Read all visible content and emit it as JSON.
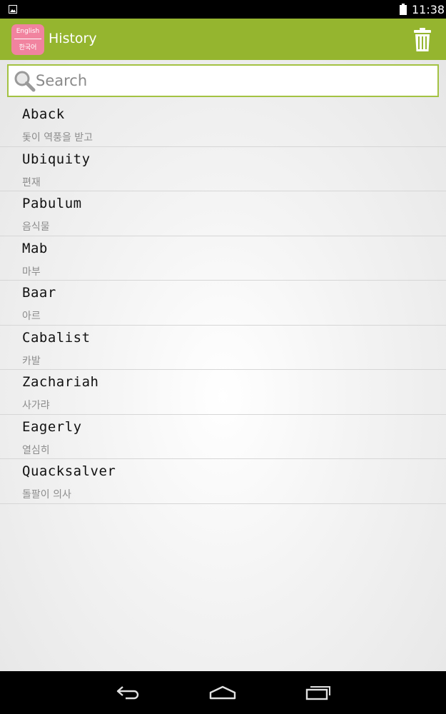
{
  "status_bar": {
    "time": "11:38",
    "icons": [
      "notification-image-icon",
      "battery-icon"
    ]
  },
  "app_bar": {
    "logo_top": "English",
    "logo_bottom": "한국어",
    "title": "History",
    "action_icon": "trash-icon",
    "accent_color": "#95b52f"
  },
  "search": {
    "placeholder": "Search",
    "value": "",
    "border_color": "#a3c242"
  },
  "history": {
    "items": [
      {
        "word": "Aback",
        "meaning": "돛이 역풍을 받고"
      },
      {
        "word": "Ubiquity",
        "meaning": "편재"
      },
      {
        "word": "Pabulum",
        "meaning": "음식물"
      },
      {
        "word": "Mab",
        "meaning": "마부"
      },
      {
        "word": "Baar",
        "meaning": "아르"
      },
      {
        "word": "Cabalist",
        "meaning": "카발"
      },
      {
        "word": "Zachariah",
        "meaning": "사가랴"
      },
      {
        "word": "Eagerly",
        "meaning": "열심히"
      },
      {
        "word": "Quacksalver",
        "meaning": "돌팔이 의사"
      }
    ]
  },
  "nav_bar": {
    "icons": [
      "back-icon",
      "home-icon",
      "recents-icon"
    ]
  }
}
